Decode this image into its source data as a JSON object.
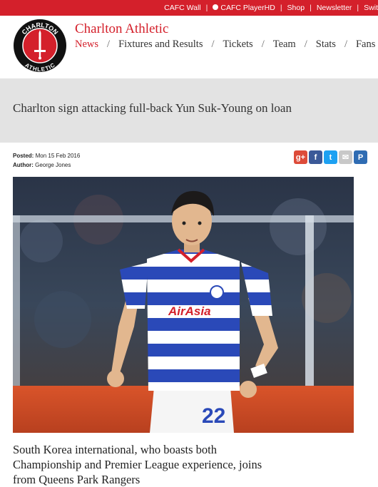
{
  "top_links": {
    "wall": "CAFC Wall",
    "player": "CAFC PlayerHD",
    "shop": "Shop",
    "newsletter": "Newsletter",
    "switch": "Swit"
  },
  "crest": {
    "top_text": "CHARLTON",
    "bottom_text": "ATHLETIC"
  },
  "site_name": "Charlton Athletic",
  "nav": {
    "items": [
      "News",
      "Fixtures and Results",
      "Tickets",
      "Team",
      "Stats",
      "Fans"
    ],
    "active": "News"
  },
  "article": {
    "title": "Charlton sign attacking full-back Yun Suk-Young on loan",
    "posted_label": "Posted:",
    "posted_value": "Mon 15 Feb 2016",
    "author_label": "Author:",
    "author_value": "George Jones",
    "standfirst": "South Korea international, who boasts both Championship and Premier League experience, joins from Queens Park Rangers"
  },
  "photo": {
    "shirt_sponsor": "AirAsia",
    "shirt_number": "22"
  },
  "share": {
    "buttons": [
      {
        "name": "gplus-share-icon",
        "label": "g+",
        "color": "#dd4b39"
      },
      {
        "name": "facebook-share-icon",
        "label": "f",
        "color": "#3b5998"
      },
      {
        "name": "twitter-share-icon",
        "label": "t",
        "color": "#1da1f2"
      },
      {
        "name": "email-share-icon",
        "label": "✉",
        "color": "#c8c8c8"
      },
      {
        "name": "pinterest-share-icon",
        "label": "P",
        "color": "#2f6cb3"
      }
    ]
  },
  "colors": {
    "brand_red": "#d4202b",
    "title_bar_grey": "#e3e3e3"
  }
}
